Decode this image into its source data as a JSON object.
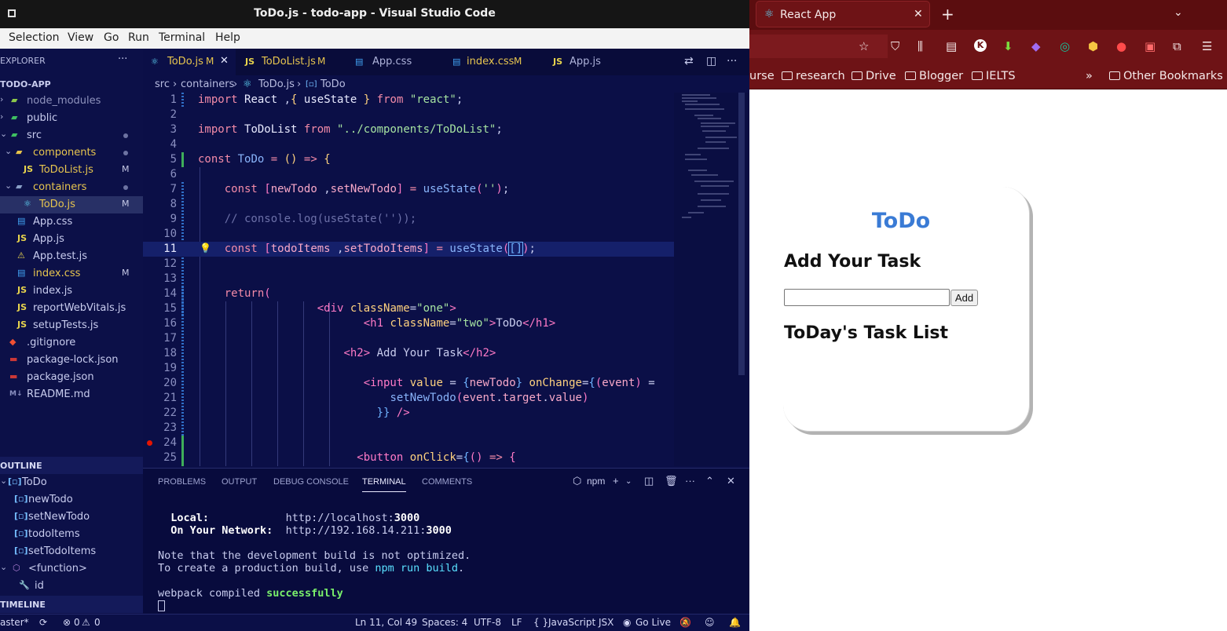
{
  "vscode": {
    "window_title": "ToDo.js - todo-app - Visual Studio Code",
    "menu": [
      "Selection",
      "View",
      "Go",
      "Run",
      "Terminal",
      "Help"
    ],
    "explorer": {
      "header": "EXPLORER",
      "project": "TODO-APP",
      "items": [
        {
          "label": "node_modules",
          "icon": "folder-node-icon",
          "badge": ""
        },
        {
          "label": "public",
          "icon": "folder-public-icon",
          "badge": ""
        },
        {
          "label": "src",
          "icon": "folder-src-icon",
          "badge": "dot"
        },
        {
          "label": "components",
          "icon": "folder-icon",
          "badge": "dot"
        },
        {
          "label": "ToDoList.js",
          "icon": "js-icon",
          "badge": "M"
        },
        {
          "label": "containers",
          "icon": "folder-icon",
          "badge": "dot"
        },
        {
          "label": "ToDo.js",
          "icon": "react-icon",
          "badge": "M"
        },
        {
          "label": "App.css",
          "icon": "css-icon",
          "badge": ""
        },
        {
          "label": "App.js",
          "icon": "js-icon",
          "badge": ""
        },
        {
          "label": "App.test.js",
          "icon": "test-icon",
          "badge": ""
        },
        {
          "label": "index.css",
          "icon": "css-icon",
          "badge": "M"
        },
        {
          "label": "index.js",
          "icon": "js-icon",
          "badge": ""
        },
        {
          "label": "reportWebVitals.js",
          "icon": "js-icon",
          "badge": ""
        },
        {
          "label": "setupTests.js",
          "icon": "js-icon",
          "badge": ""
        },
        {
          "label": ".gitignore",
          "icon": "git-icon",
          "badge": ""
        },
        {
          "label": "package-lock.json",
          "icon": "npm-icon",
          "badge": ""
        },
        {
          "label": "package.json",
          "icon": "npm-icon",
          "badge": ""
        },
        {
          "label": "README.md",
          "icon": "markdown-icon",
          "badge": ""
        }
      ]
    },
    "outline": {
      "header": "OUTLINE",
      "items": [
        "ToDo",
        "newTodo",
        "setNewTodo",
        "todoItems",
        "setTodoItems",
        "<function>",
        "id"
      ]
    },
    "timeline_header": "TIMELINE",
    "tabs": [
      {
        "label": "ToDo.js",
        "badge": "M",
        "icon": "react-icon"
      },
      {
        "label": "ToDoList.js",
        "badge": "M",
        "icon": "js-icon"
      },
      {
        "label": "App.css",
        "badge": "",
        "icon": "css-icon"
      },
      {
        "label": "index.css",
        "badge": "M",
        "icon": "css-icon"
      },
      {
        "label": "App.js",
        "badge": "",
        "icon": "js-icon"
      }
    ],
    "breadcrumb": [
      "src",
      "containers",
      "ToDo.js",
      "ToDo"
    ],
    "line_numbers": [
      "1",
      "2",
      "3",
      "4",
      "5",
      "6",
      "7",
      "8",
      "9",
      "10",
      "11",
      "12",
      "13",
      "14",
      "15",
      "16",
      "17",
      "18",
      "19",
      "20",
      "21",
      "22",
      "23",
      "24",
      "25"
    ],
    "panel": {
      "tabs": [
        "PROBLEMS",
        "OUTPUT",
        "DEBUG CONSOLE",
        "TERMINAL",
        "COMMENTS"
      ],
      "active_tab": "TERMINAL",
      "shell": "npm",
      "terminal": {
        "local_label": "Local:",
        "local_url": "http://localhost:",
        "local_port": "3000",
        "network_label": "On Your Network:",
        "network_url": "http://192.168.14.211:",
        "network_port": "3000",
        "note1": "Note that the development build is not optimized.",
        "note2a": "To create a production build, use ",
        "note2b": "npm run build",
        "note2c": ".",
        "compiled_a": "webpack compiled ",
        "compiled_b": "successfully"
      }
    },
    "status": {
      "branch": "aster*",
      "errors": "0",
      "warnings": "0",
      "position": "Ln 11, Col 49",
      "spaces": "Spaces: 4",
      "encoding": "UTF-8",
      "eol": "LF",
      "language": "JavaScript JSX",
      "golive": "Go Live"
    }
  },
  "browser": {
    "tab_title": "React App",
    "bookmarks": [
      "urse",
      "research",
      "Drive",
      "Blogger",
      "IELTS",
      "Other Bookmarks"
    ],
    "app": {
      "title": "ToDo",
      "heading": "Add Your Task",
      "input_value": "",
      "add_label": "Add",
      "list_heading": "ToDay's Task List"
    }
  }
}
